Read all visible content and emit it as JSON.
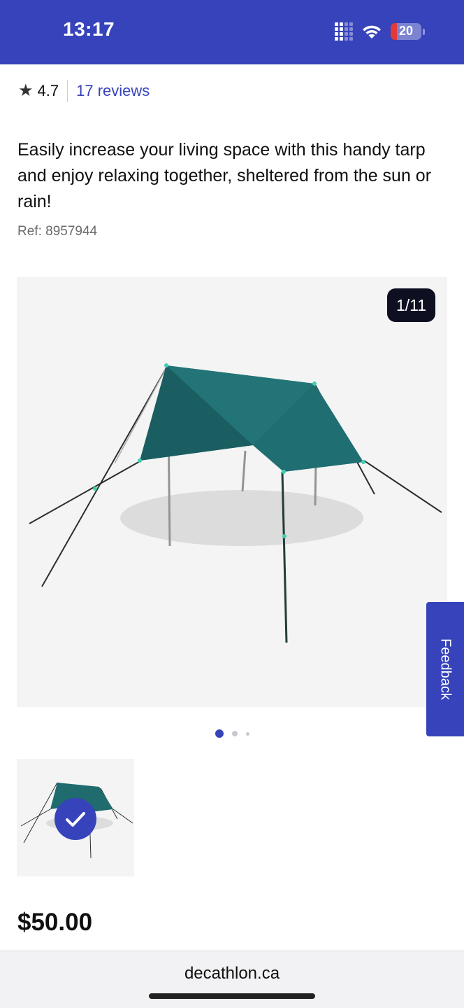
{
  "status_bar": {
    "time": "13:17",
    "battery_level": "20",
    "battery_color": "#e53935",
    "signal_icon": "cellular-signal-icon",
    "wifi_icon": "wifi-icon",
    "background": "#3643ba"
  },
  "product": {
    "rating": "4.7",
    "rating_icon": "star-icon",
    "reviews_link": "17 reviews",
    "description": "Easily increase your living space with this handy tarp and enjoy relaxing together, sheltered from the sun or rain!",
    "ref": "Ref: 8957944",
    "price": "$50.00"
  },
  "gallery": {
    "counter": "1/11",
    "current_index": 1,
    "total_images": 11,
    "page_dots": 3,
    "active_dot": 1,
    "thumbnail_selected": true,
    "tarp_color": "#1f6b6e"
  },
  "feedback_tab": {
    "label": "Feedback"
  },
  "browser": {
    "url": "decathlon.ca"
  },
  "colors": {
    "brand": "#3643ba",
    "text": "#101010",
    "muted": "#6b6b6b",
    "counter_bg": "#0e1022"
  }
}
